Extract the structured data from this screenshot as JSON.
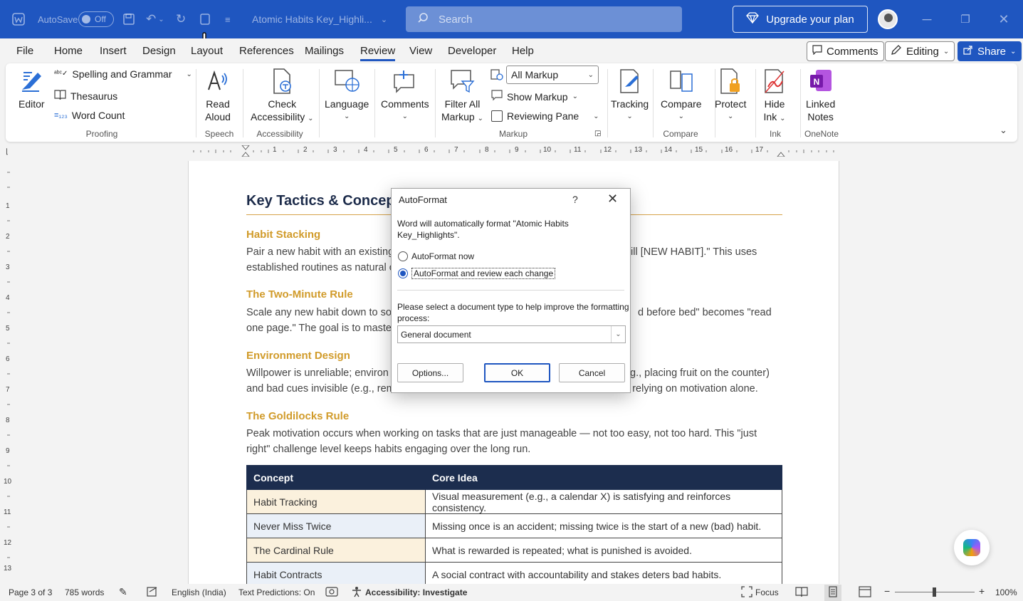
{
  "titlebar": {
    "autosave_label": "AutoSave",
    "autosave_state": "Off",
    "doc_title": "Atomic Habits Key_Highli...",
    "search_placeholder": "Search",
    "upgrade_label": "Upgrade your plan"
  },
  "menu": {
    "tabs": [
      "File",
      "Home",
      "Insert",
      "Design",
      "Layout",
      "References",
      "Mailings",
      "Review",
      "View",
      "Developer",
      "Help"
    ],
    "active_tab": "Review",
    "comments_label": "Comments",
    "editing_label": "Editing",
    "share_label": "Share"
  },
  "ribbon": {
    "editor": "Editor",
    "spelling": "Spelling and Grammar",
    "thesaurus": "Thesaurus",
    "word_count": "Word Count",
    "proofing": "Proofing",
    "read_aloud_1": "Read",
    "read_aloud_2": "Aloud",
    "speech": "Speech",
    "check_acc_1": "Check",
    "check_acc_2": "Accessibility",
    "accessibility": "Accessibility",
    "language": "Language",
    "comments": "Comments",
    "filter_1": "Filter All",
    "filter_2": "Markup",
    "all_markup": "All Markup",
    "show_markup": "Show Markup",
    "reviewing_pane": "Reviewing Pane",
    "markup": "Markup",
    "tracking": "Tracking",
    "compare_btn": "Compare",
    "compare_group": "Compare",
    "protect": "Protect",
    "hide_ink_1": "Hide",
    "hide_ink_2": "Ink",
    "ink": "Ink",
    "linked_1": "Linked",
    "linked_2": "Notes",
    "onenote": "OneNote"
  },
  "ruler": {
    "h_ticks": [
      "1",
      "2",
      "3",
      "4",
      "5",
      "6",
      "7",
      "8",
      "9",
      "10",
      "11",
      "12",
      "13",
      "14",
      "15",
      "16",
      "17"
    ],
    "v_ticks": [
      "1",
      "2",
      "3",
      "4",
      "5",
      "6",
      "7",
      "8",
      "9",
      "10",
      "11",
      "12",
      "13"
    ]
  },
  "document": {
    "heading": "Key Tactics & Concept",
    "sections": [
      {
        "title": "Habit Stacking",
        "line1_left": "Pair a new habit with an existing",
        "line1_right": "ill [NEW HABIT].\" This uses",
        "line2_left": "established routines as natural c"
      },
      {
        "title": "The Two-Minute Rule",
        "line1_left": "Scale any new habit down to sor",
        "line1_right": "d before bed\" becomes \"read",
        "line2_left": "one page.\" The goal is to master"
      },
      {
        "title": "Environment Design",
        "line1_left": "Willpower is unreliable; environ",
        "line1_right": ".g., placing fruit on the counter)",
        "line2_left": "and bad cues invisible (e.g., remo",
        "line2_right": "han relying on motivation alone."
      },
      {
        "title": "The Goldilocks Rule",
        "line1_left": "Peak motivation occurs when working on tasks that are just manageable — not too easy, not too hard. This \"just",
        "line2_left": "right\" challenge level keeps habits engaging over the long run."
      }
    ],
    "table": {
      "headers": [
        "Concept",
        "Core Idea"
      ],
      "rows": [
        [
          "Habit Tracking",
          "Visual measurement (e.g., a calendar X) is satisfying and reinforces consistency."
        ],
        [
          "Never Miss Twice",
          "Missing once is an accident; missing twice is the start of a new (bad) habit."
        ],
        [
          "The Cardinal Rule",
          "What is rewarded is repeated; what is punished is avoided."
        ],
        [
          "Habit Contracts",
          "A social contract with accountability and stakes deters bad habits."
        ]
      ]
    }
  },
  "dialog": {
    "title": "AutoFormat",
    "help": "?",
    "message_1": "Word will automatically format \"Atomic Habits",
    "message_2": "Key_Highlights\".",
    "option_now": "AutoFormat now",
    "option_review": "AutoFormat and review each change",
    "selected_option": "AutoFormat and review each change",
    "doctype_prompt_1": "Please select a document type to help improve the formatting",
    "doctype_prompt_2": "process:",
    "doctype_value": "General document",
    "options_btn": "Options...",
    "ok_btn": "OK",
    "cancel_btn": "Cancel"
  },
  "status": {
    "page": "Page 3 of 3",
    "words": "785 words",
    "language": "English (India)",
    "text_predictions": "Text Predictions: On",
    "accessibility": "Accessibility: Investigate",
    "focus": "Focus",
    "zoom": "100%"
  },
  "colors": {
    "titlebar": "#1f56c0",
    "heading": "#1c2b4a",
    "section_title": "#d19b2a",
    "table_header": "#1c2d4e"
  }
}
